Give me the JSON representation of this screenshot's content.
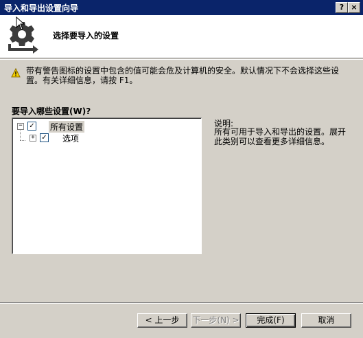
{
  "window": {
    "title": "导入和导出设置向导",
    "help_glyph": "?",
    "close_glyph": "×"
  },
  "header": {
    "title": "选择要导入的设置",
    "icon": "gear-arrow-icon"
  },
  "warning": {
    "icon": "warning-icon",
    "text": "带有警告图标的设置中包含的值可能会危及计算机的安全。默认情况下不会选择这些设置。有关详细信息，请按 F1。"
  },
  "tree": {
    "label": "要导入哪些设置(W)?",
    "items": [
      {
        "label": "所有设置",
        "expander": "−",
        "checked": "✓"
      },
      {
        "label": "选项",
        "expander": "+",
        "checked": "✓"
      }
    ]
  },
  "description": {
    "label": "说明:",
    "text": "所有可用于导入和导出的设置。展开此类别可以查看更多详细信息。"
  },
  "buttons": {
    "back": "< 上一步",
    "next": "下一步(N) >",
    "finish": "完成(F)",
    "cancel": "取消"
  },
  "colors": {
    "titlebar": "#0a246a",
    "face": "#d4d0c8",
    "window_bg": "#ffffff",
    "disabled_text": "#808080"
  }
}
